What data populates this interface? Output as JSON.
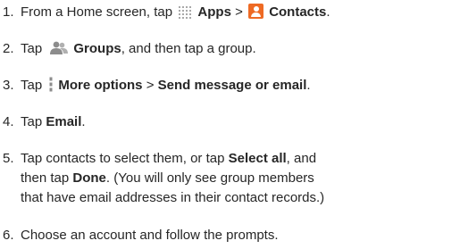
{
  "steps": [
    {
      "num": "1.",
      "t1": "From a Home screen, tap ",
      "b1": "Apps",
      "t2": " > ",
      "b2": "Contacts",
      "t3": "."
    },
    {
      "num": "2.",
      "t1": "Tap ",
      "b1": "Groups",
      "t2": ", and then tap a group."
    },
    {
      "num": "3.",
      "t1": "Tap ",
      "b1": "More options",
      "t2": " > ",
      "b2": "Send message or email",
      "t3": "."
    },
    {
      "num": "4.",
      "t1": "Tap ",
      "b1": "Email",
      "t2": "."
    },
    {
      "num": "5.",
      "line1_t1": "Tap contacts to select them, or tap ",
      "line1_b1": "Select all",
      "line1_t2": ", and",
      "line2_t1": "then tap ",
      "line2_b1": "Done",
      "line2_t2": ". (You will only see group members",
      "line3": "that have email addresses in their contact records.)"
    },
    {
      "num": "6.",
      "t1": "Choose an account and follow the prompts."
    }
  ],
  "icons": {
    "apps": "apps-grid-icon",
    "contacts": "contacts-icon",
    "groups": "groups-icon",
    "more_options": "more-options-icon"
  },
  "colors": {
    "text": "#262626",
    "contacts_icon": "#ee6a24",
    "groups_icon": "#8c8c8c",
    "more_icon": "#8c8c8c",
    "apps_icon": "#9a9a9a"
  }
}
